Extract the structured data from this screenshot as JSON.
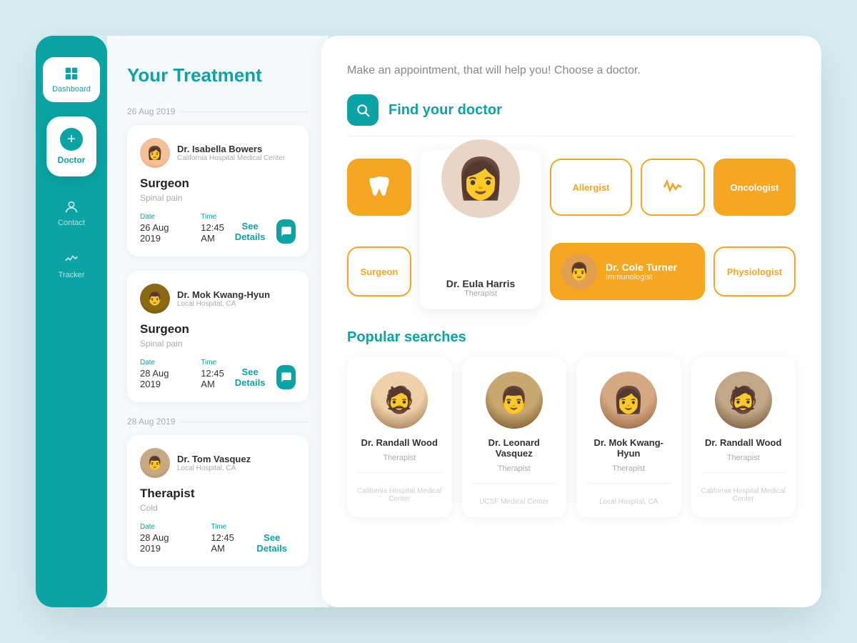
{
  "sidebar": {
    "items": [
      {
        "id": "dashboard",
        "label": "Dashboard",
        "active": false
      },
      {
        "id": "doctor",
        "label": "Doctor",
        "active": true
      },
      {
        "id": "contact",
        "label": "Contact",
        "active": false
      },
      {
        "id": "tracker",
        "label": "Tracker",
        "active": false
      }
    ]
  },
  "left_panel": {
    "title": "Your Treatment",
    "appointments": [
      {
        "date_group": "26 Aug 2019",
        "doctor_name": "Dr. Isabella Bowers",
        "hospital": "California Hospital Medical Center",
        "specialty": "Surgeon",
        "condition": "Spinal pain",
        "date_label": "Date",
        "date_value": "26 Aug 2019",
        "time_label": "Time",
        "time_value": "12:45 AM",
        "see_details": "See Details",
        "avatar_class": "avatar-female-1"
      },
      {
        "date_group": "",
        "doctor_name": "Dr. Mok Kwang-Hyun",
        "hospital": "Local Hospital, CA",
        "specialty": "Surgeon",
        "condition": "Spinal pain",
        "date_label": "Date",
        "date_value": "28 Aug 2019",
        "time_label": "Time",
        "time_value": "12:45 AM",
        "see_details": "See Details",
        "avatar_class": "avatar-male-1"
      },
      {
        "date_group": "28 Aug 2019",
        "doctor_name": "Dr. Tom Vasquez",
        "hospital": "Local Hospital, CA",
        "specialty": "Therapist",
        "condition": "Cold",
        "date_label": "Date",
        "date_value": "28 Aug 2019",
        "time_label": "Time",
        "time_value": "12:45 AM",
        "see_details": "See Details",
        "avatar_class": "avatar-male-2"
      }
    ]
  },
  "right_panel": {
    "tagline": "Make an appointment, that will help you! Choose a doctor.",
    "find_doctor_label": "Find your doctor",
    "categories": [
      {
        "label": "",
        "type": "tooth-icon",
        "filled": true
      },
      {
        "label": "Dr. Eula Harris",
        "role": "Therapist",
        "type": "doctor-card"
      },
      {
        "label": "Allergist",
        "type": "text",
        "filled": false
      },
      {
        "label": "",
        "type": "heart-icon",
        "filled": false
      },
      {
        "label": "Oncologist",
        "type": "text",
        "filled": true
      },
      {
        "label": "Surgeon",
        "type": "text",
        "filled": false
      },
      {
        "label": "Dr. Cole Turner",
        "role": "Immunologist",
        "type": "selected-doctor"
      },
      {
        "label": "Physiologist",
        "type": "text",
        "filled": false
      }
    ],
    "popular_section_title": "Popular searches",
    "popular_doctors": [
      {
        "name": "Dr. Randall Wood",
        "role": "Therapist",
        "hospital": "California Hospital Medical Center",
        "avatar_class": "avatar-male-curly"
      },
      {
        "name": "Dr. Leonard Vasquez",
        "role": "Therapist",
        "hospital": "UCSF Medical Center",
        "avatar_class": "avatar-male-dark"
      },
      {
        "name": "Dr. Mok Kwang-Hyun",
        "role": "Therapist",
        "hospital": "Local Hospital, CA",
        "avatar_class": "avatar-female-3"
      },
      {
        "name": "Dr. Randall Wood",
        "role": "Therapist",
        "hospital": "California Hospital Medical Center",
        "avatar_class": "avatar-male-glasses"
      }
    ]
  }
}
